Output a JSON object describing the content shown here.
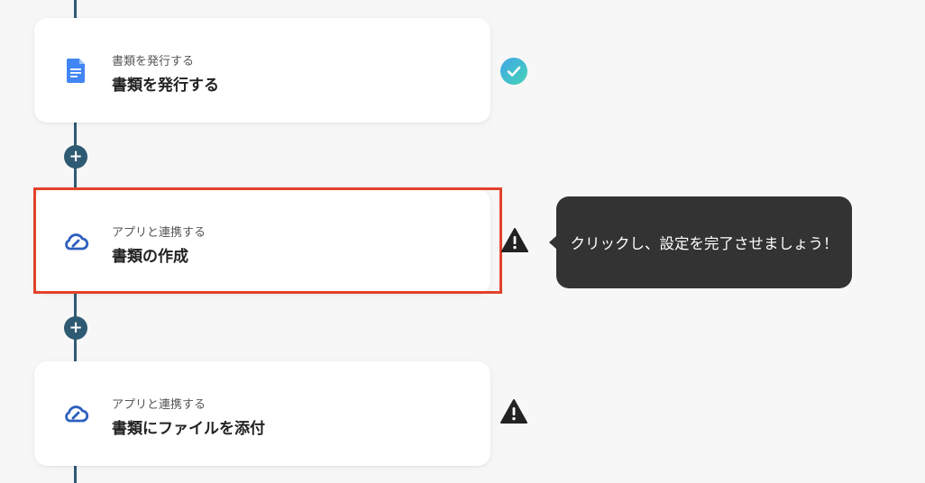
{
  "steps": [
    {
      "subtitle": "書類を発行する",
      "title": "書類を発行する",
      "icon": "google-docs-icon",
      "status": "complete"
    },
    {
      "subtitle": "アプリと連携する",
      "title": "書類の作成",
      "icon": "cloud-sign-icon",
      "status": "warning"
    },
    {
      "subtitle": "アプリと連携する",
      "title": "書類にファイルを添付",
      "icon": "cloud-sign-icon",
      "status": "warning"
    }
  ],
  "add_button_label": "+",
  "tooltip": {
    "text": "クリックし、設定を完了させましょう！"
  },
  "colors": {
    "line": "#2f5a73",
    "highlight": "#e2422a",
    "check": "#3fc4d0",
    "warning": "#222222",
    "tooltip_bg": "#333333",
    "docs_blue": "#4285f4",
    "cloud_blue": "#2d5fbf"
  }
}
